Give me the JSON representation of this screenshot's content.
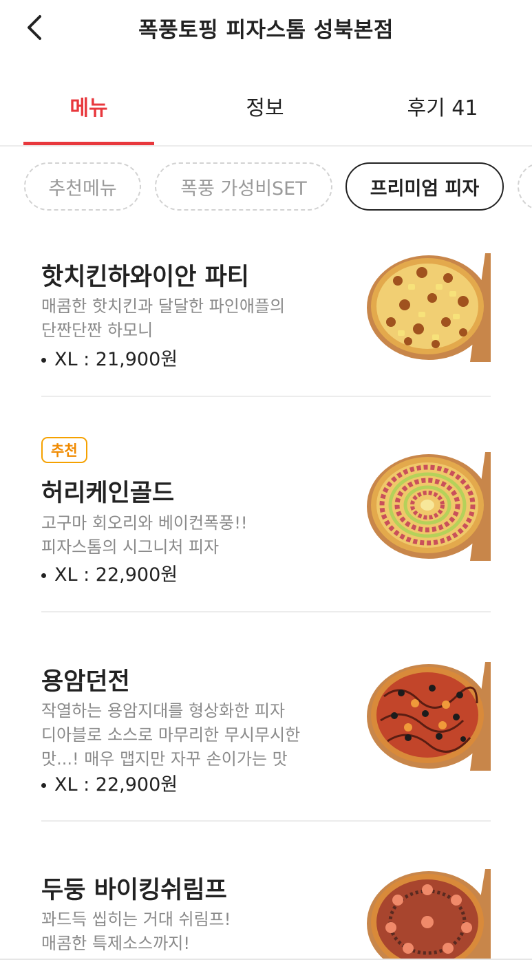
{
  "header": {
    "title": "폭풍토핑 피자스톰 성북본점",
    "back_icon": "chevron-left-icon"
  },
  "tabs": [
    {
      "label": "메뉴",
      "active": true
    },
    {
      "label": "정보",
      "active": false
    },
    {
      "label": "후기 41",
      "active": false
    }
  ],
  "accent_color": "#e8383d",
  "categories": [
    {
      "label": "추천메뉴",
      "selected": false
    },
    {
      "label": "폭풍 가성비SET",
      "selected": false
    },
    {
      "label": "프리미엄 피자",
      "selected": true
    },
    {
      "label": "",
      "selected": false
    }
  ],
  "menu_items": [
    {
      "badge": "",
      "name": "핫치킨하와이안 파티",
      "desc_lines": [
        "매콤한 핫치킨과 달달한 파인애플의",
        "단짠단짠 하모니"
      ],
      "price": "XL : 21,900원",
      "image": "hot-chicken-hawaiian-pizza"
    },
    {
      "badge": "추천",
      "name": "허리케인골드",
      "desc_lines": [
        "고구마 회오리와 베이컨폭풍!!",
        "피자스톰의 시그니처 피자"
      ],
      "price": "XL : 22,900원",
      "image": "hurricane-gold-pizza"
    },
    {
      "badge": "",
      "name": "용암던전",
      "desc_lines": [
        "작열하는 용암지대를 형상화한 피자",
        "디아블로 소스로 마무리한 무시무시한",
        "맛...! 매우 맵지만 자꾸 손이가는 맛"
      ],
      "price": "XL : 22,900원",
      "image": "lava-dungeon-pizza"
    },
    {
      "badge": "",
      "name": "두둥 바이킹쉬림프",
      "desc_lines": [
        "꽈드득 씹히는 거대 쉬림프!",
        "매콤한 특제소스까지!"
      ],
      "price": "",
      "image": "viking-shrimp-pizza"
    }
  ]
}
